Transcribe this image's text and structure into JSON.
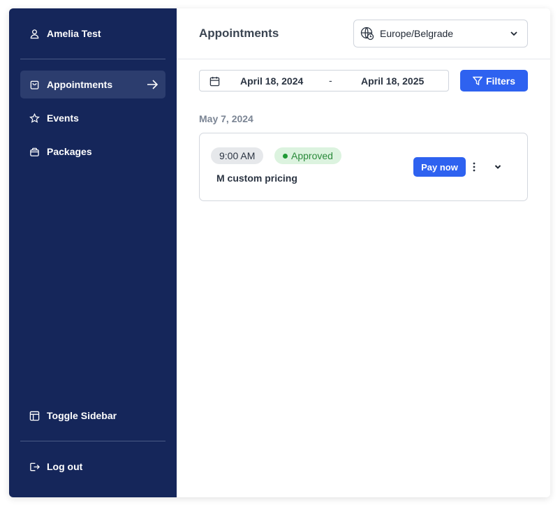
{
  "sidebar": {
    "user": {
      "label": "Amelia Test",
      "icon": "user-icon"
    },
    "items": [
      {
        "label": "Appointments",
        "icon": "shopping-bag-icon",
        "active": true
      },
      {
        "label": "Events",
        "icon": "star-icon",
        "active": false
      },
      {
        "label": "Packages",
        "icon": "package-icon",
        "active": false
      }
    ],
    "toggle_label": "Toggle Sidebar",
    "logout_label": "Log out",
    "colors": {
      "background": "#15265a",
      "active": "#2c3d6e"
    }
  },
  "header": {
    "title": "Appointments",
    "timezone": {
      "value": "Europe/Belgrade",
      "icon": "globe-clock-icon"
    }
  },
  "toolbar": {
    "date_from": "April 18, 2024",
    "separator": "-",
    "date_to": "April 18, 2025",
    "filters_label": "Filters"
  },
  "list": {
    "date_heading": "May 7, 2024",
    "appointments": [
      {
        "time": "9:00 AM",
        "status": "Approved",
        "service": "M custom pricing",
        "pay_label": "Pay now"
      }
    ]
  },
  "colors": {
    "accent": "#2e62f0",
    "status_approved": "#2a8a3a"
  }
}
